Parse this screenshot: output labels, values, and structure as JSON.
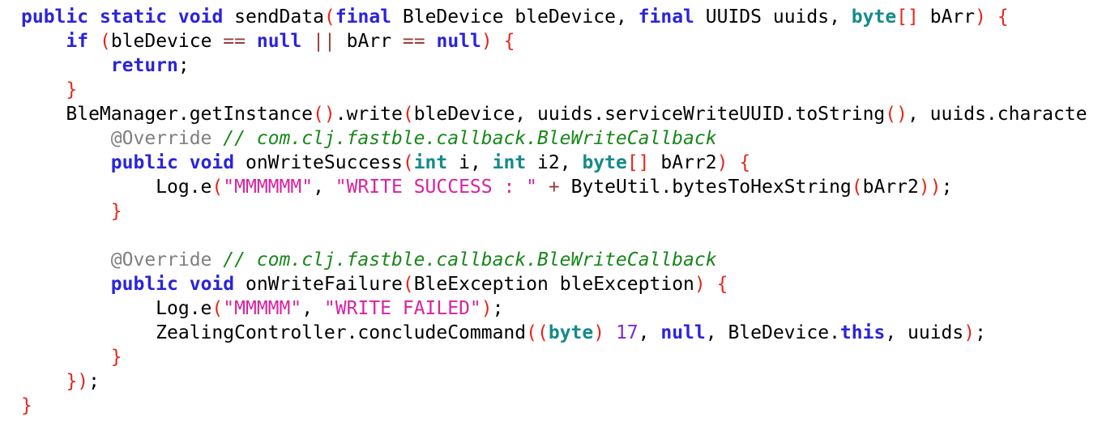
{
  "editor": {
    "colors": {
      "keyword": "#2a23dd",
      "type": "#148a8a",
      "bracket": "#e5261b",
      "operator": "#9a3b3b",
      "string": "#d9239f",
      "number": "#7a2bd6",
      "annotation": "#7f7f7f",
      "comment": "#17871a",
      "text": "#000000"
    },
    "lines": [
      {
        "indent": "",
        "tokens": [
          {
            "t": "kw",
            "v": "public"
          },
          {
            "t": "txt",
            "v": " "
          },
          {
            "t": "kw",
            "v": "static"
          },
          {
            "t": "txt",
            "v": " "
          },
          {
            "t": "kw",
            "v": "void"
          },
          {
            "t": "txt",
            "v": " sendData"
          },
          {
            "t": "br",
            "v": "("
          },
          {
            "t": "kw",
            "v": "final"
          },
          {
            "t": "txt",
            "v": " BleDevice bleDevice, "
          },
          {
            "t": "kw",
            "v": "final"
          },
          {
            "t": "txt",
            "v": " UUIDS uuids, "
          },
          {
            "t": "ty",
            "v": "byte"
          },
          {
            "t": "br",
            "v": "[]"
          },
          {
            "t": "txt",
            "v": " bArr"
          },
          {
            "t": "br",
            "v": ")"
          },
          {
            "t": "txt",
            "v": " "
          },
          {
            "t": "br",
            "v": "{"
          }
        ]
      },
      {
        "indent": "    ",
        "tokens": [
          {
            "t": "kw",
            "v": "if"
          },
          {
            "t": "txt",
            "v": " "
          },
          {
            "t": "br",
            "v": "("
          },
          {
            "t": "txt",
            "v": "bleDevice "
          },
          {
            "t": "op",
            "v": "=="
          },
          {
            "t": "txt",
            "v": " "
          },
          {
            "t": "kw",
            "v": "null"
          },
          {
            "t": "txt",
            "v": " "
          },
          {
            "t": "op",
            "v": "||"
          },
          {
            "t": "txt",
            "v": " bArr "
          },
          {
            "t": "op",
            "v": "=="
          },
          {
            "t": "txt",
            "v": " "
          },
          {
            "t": "kw",
            "v": "null"
          },
          {
            "t": "br",
            "v": ")"
          },
          {
            "t": "txt",
            "v": " "
          },
          {
            "t": "br",
            "v": "{"
          }
        ]
      },
      {
        "indent": "        ",
        "tokens": [
          {
            "t": "kw",
            "v": "return"
          },
          {
            "t": "txt",
            "v": ";"
          }
        ]
      },
      {
        "indent": "    ",
        "tokens": [
          {
            "t": "br",
            "v": "}"
          }
        ]
      },
      {
        "indent": "    ",
        "tokens": [
          {
            "t": "txt",
            "v": "BleManager.getInstance"
          },
          {
            "t": "br",
            "v": "()"
          },
          {
            "t": "txt",
            "v": ".write"
          },
          {
            "t": "br",
            "v": "("
          },
          {
            "t": "txt",
            "v": "bleDevice, uuids.serviceWriteUUID.toString"
          },
          {
            "t": "br",
            "v": "()"
          },
          {
            "t": "txt",
            "v": ", uuids.characte"
          }
        ]
      },
      {
        "indent": "        ",
        "tokens": [
          {
            "t": "ann",
            "v": "@Override"
          },
          {
            "t": "txt",
            "v": " "
          },
          {
            "t": "cmt",
            "v": "// com.clj.fastble.callback.BleWriteCallback"
          }
        ]
      },
      {
        "indent": "        ",
        "tokens": [
          {
            "t": "kw",
            "v": "public"
          },
          {
            "t": "txt",
            "v": " "
          },
          {
            "t": "kw",
            "v": "void"
          },
          {
            "t": "txt",
            "v": " onWriteSuccess"
          },
          {
            "t": "br",
            "v": "("
          },
          {
            "t": "ty",
            "v": "int"
          },
          {
            "t": "txt",
            "v": " i, "
          },
          {
            "t": "ty",
            "v": "int"
          },
          {
            "t": "txt",
            "v": " i2, "
          },
          {
            "t": "ty",
            "v": "byte"
          },
          {
            "t": "br",
            "v": "[]"
          },
          {
            "t": "txt",
            "v": " bArr2"
          },
          {
            "t": "br",
            "v": ")"
          },
          {
            "t": "txt",
            "v": " "
          },
          {
            "t": "br",
            "v": "{"
          }
        ]
      },
      {
        "indent": "            ",
        "tokens": [
          {
            "t": "txt",
            "v": "Log.e"
          },
          {
            "t": "br",
            "v": "("
          },
          {
            "t": "str",
            "v": "\"MMMMMM\""
          },
          {
            "t": "txt",
            "v": ", "
          },
          {
            "t": "str",
            "v": "\"WRITE SUCCESS : \""
          },
          {
            "t": "txt",
            "v": " "
          },
          {
            "t": "op",
            "v": "+"
          },
          {
            "t": "txt",
            "v": " ByteUtil.bytesToHexString"
          },
          {
            "t": "br",
            "v": "("
          },
          {
            "t": "txt",
            "v": "bArr2"
          },
          {
            "t": "br",
            "v": "))"
          },
          {
            "t": "txt",
            "v": ";"
          }
        ]
      },
      {
        "indent": "        ",
        "tokens": [
          {
            "t": "br",
            "v": "}"
          }
        ]
      },
      {
        "indent": "",
        "tokens": []
      },
      {
        "indent": "        ",
        "tokens": [
          {
            "t": "ann",
            "v": "@Override"
          },
          {
            "t": "txt",
            "v": " "
          },
          {
            "t": "cmt",
            "v": "// com.clj.fastble.callback.BleWriteCallback"
          }
        ]
      },
      {
        "indent": "        ",
        "tokens": [
          {
            "t": "kw",
            "v": "public"
          },
          {
            "t": "txt",
            "v": " "
          },
          {
            "t": "kw",
            "v": "void"
          },
          {
            "t": "txt",
            "v": " onWriteFailure"
          },
          {
            "t": "br",
            "v": "("
          },
          {
            "t": "txt",
            "v": "BleException bleException"
          },
          {
            "t": "br",
            "v": ")"
          },
          {
            "t": "txt",
            "v": " "
          },
          {
            "t": "br",
            "v": "{"
          }
        ]
      },
      {
        "indent": "            ",
        "tokens": [
          {
            "t": "txt",
            "v": "Log.e"
          },
          {
            "t": "br",
            "v": "("
          },
          {
            "t": "str",
            "v": "\"MMMMM\""
          },
          {
            "t": "txt",
            "v": ", "
          },
          {
            "t": "str",
            "v": "\"WRITE FAILED\""
          },
          {
            "t": "br",
            "v": ")"
          },
          {
            "t": "txt",
            "v": ";"
          }
        ]
      },
      {
        "indent": "            ",
        "tokens": [
          {
            "t": "txt",
            "v": "ZealingController.concludeCommand"
          },
          {
            "t": "br",
            "v": "(("
          },
          {
            "t": "ty",
            "v": "byte"
          },
          {
            "t": "br",
            "v": ")"
          },
          {
            "t": "txt",
            "v": " "
          },
          {
            "t": "num",
            "v": "17"
          },
          {
            "t": "txt",
            "v": ", "
          },
          {
            "t": "kw",
            "v": "null"
          },
          {
            "t": "txt",
            "v": ", BleDevice."
          },
          {
            "t": "kw",
            "v": "this"
          },
          {
            "t": "txt",
            "v": ", uuids"
          },
          {
            "t": "br",
            "v": ")"
          },
          {
            "t": "txt",
            "v": ";"
          }
        ]
      },
      {
        "indent": "        ",
        "tokens": [
          {
            "t": "br",
            "v": "}"
          }
        ]
      },
      {
        "indent": "    ",
        "tokens": [
          {
            "t": "br",
            "v": "})"
          },
          {
            "t": "txt",
            "v": ";"
          }
        ]
      },
      {
        "indent": "",
        "tokens": [
          {
            "t": "br",
            "v": "}"
          }
        ]
      }
    ]
  }
}
